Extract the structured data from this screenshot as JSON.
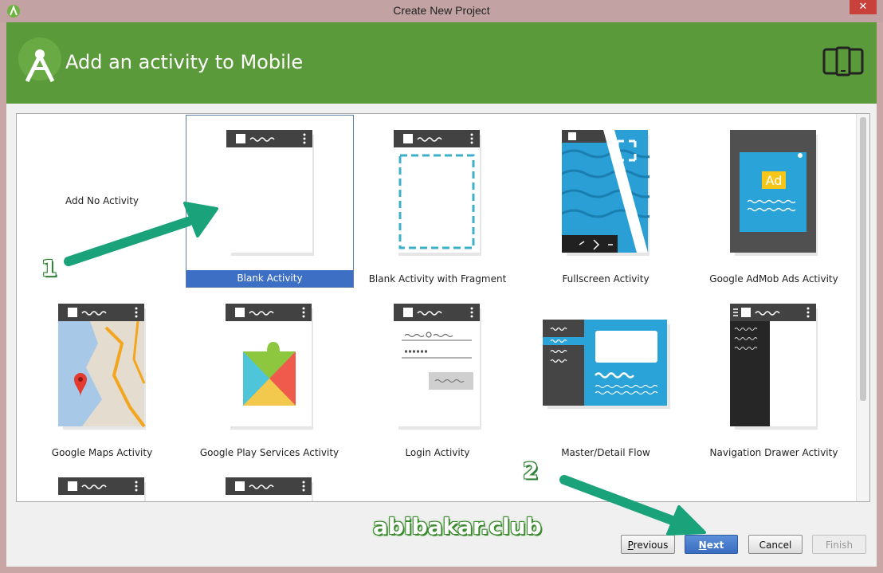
{
  "window": {
    "title": "Create New Project",
    "close_glyph": "✕"
  },
  "header": {
    "heading": "Add an activity to Mobile"
  },
  "tiles": [
    {
      "label": "Add No Activity"
    },
    {
      "label": "Blank Activity"
    },
    {
      "label": "Blank Activity with Fragment"
    },
    {
      "label": "Fullscreen Activity"
    },
    {
      "label": "Google AdMob Ads Activity",
      "ad_text": "Ad"
    },
    {
      "label": "Google Maps Activity"
    },
    {
      "label": "Google Play Services Activity"
    },
    {
      "label": "Login Activity"
    },
    {
      "label": "Master/Detail Flow"
    },
    {
      "label": "Navigation Drawer Activity"
    }
  ],
  "buttons": {
    "previous": {
      "mnemonic": "P",
      "rest": "revious"
    },
    "next": {
      "mnemonic": "N",
      "rest": "ext"
    },
    "cancel": "Cancel",
    "finish": "Finish"
  },
  "annotations": {
    "step1": "1",
    "step2": "2",
    "watermark": "abibakar.club"
  },
  "colors": {
    "header": "#5b9a3a",
    "selection": "#3d6fc5",
    "arrow": "#1aa37a"
  }
}
